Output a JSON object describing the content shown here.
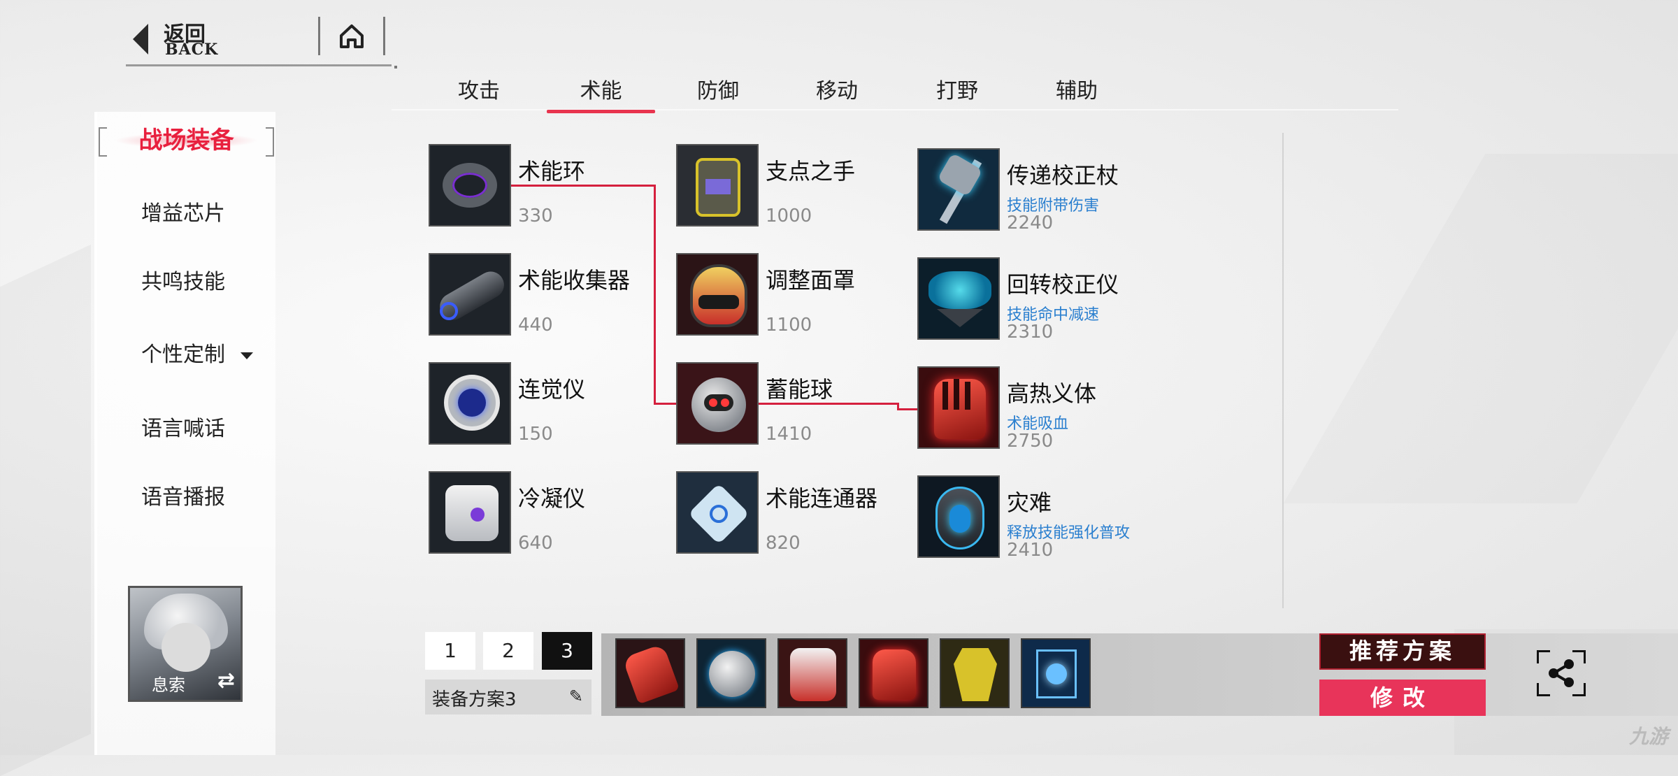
{
  "nav": {
    "back_zh": "返回",
    "back_en": "BACK",
    "home_icon": "home-icon"
  },
  "tabs": [
    {
      "label": "攻击",
      "active": false
    },
    {
      "label": "术能",
      "active": true
    },
    {
      "label": "防御",
      "active": false
    },
    {
      "label": "移动",
      "active": false
    },
    {
      "label": "打野",
      "active": false
    },
    {
      "label": "辅助",
      "active": false
    }
  ],
  "sidebar": {
    "title": "战场装备",
    "items": [
      "增益芯片",
      "共鸣技能",
      "个性定制",
      "语言喊话",
      "语音播报"
    ],
    "character_name": "息索"
  },
  "items": {
    "col1": [
      {
        "name": "术能环",
        "price": "330"
      },
      {
        "name": "术能收集器",
        "price": "440"
      },
      {
        "name": "连觉仪",
        "price": "150"
      },
      {
        "name": "冷凝仪",
        "price": "640"
      }
    ],
    "col2": [
      {
        "name": "支点之手",
        "price": "1000"
      },
      {
        "name": "调整面罩",
        "price": "1100"
      },
      {
        "name": "蓄能球",
        "price": "1410"
      },
      {
        "name": "术能连通器",
        "price": "820"
      }
    ],
    "col3": [
      {
        "name": "传递校正杖",
        "desc": "技能附带伤害",
        "price": "2240"
      },
      {
        "name": "回转校正仪",
        "desc": "技能命中减速",
        "price": "2310"
      },
      {
        "name": "高热义体",
        "desc": "术能吸血",
        "price": "2750"
      },
      {
        "name": "灾难",
        "desc": "释放技能强化普攻",
        "price": "2410"
      }
    ]
  },
  "bottom": {
    "pages": [
      "1",
      "2",
      "3"
    ],
    "active_page": "3",
    "scheme_label": "装备方案3",
    "recommend_label": "推荐方案",
    "modify_label": "修改",
    "watermark": "九游"
  },
  "colors": {
    "accent": "#e8344e",
    "link_blue": "#2a7fcf",
    "price_gray": "#8a8a8a"
  }
}
